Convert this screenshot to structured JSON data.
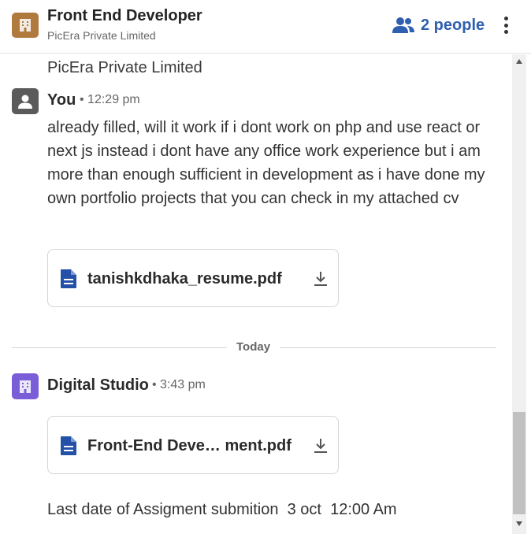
{
  "colors": {
    "org_logo": "#b07a3e",
    "digital_studio_logo": "#7a5ed8",
    "you_avatar": "#5b5b5b",
    "accent": "#2f5fb0",
    "file_icon": "#2451a8"
  },
  "header": {
    "title": "Front End Developer",
    "subtitle": "PicEra Private Limited",
    "people_label": "2 people",
    "people_icon": "people-icon",
    "more_icon": "kebab-menu-icon"
  },
  "thread": {
    "previous_text": "PicEra Private Limited",
    "message_1": {
      "sender": "You",
      "time": "• 12:29 pm",
      "text": "already filled, will it work if i dont work on php and use react or next js instead i dont have any office work experience but i am more than enough sufficient in development as i have done my own portfolio projects that you can check in my attached cv",
      "attachment": "tanishkdhaka_resume.pdf"
    },
    "divider_label": "Today",
    "message_2": {
      "sender": "Digital Studio",
      "time": "• 3:43 pm",
      "attachment": "Front-End Deve… ment.pdf",
      "text": "Last date of Assigment submition  3 oct  12:00 Am"
    }
  }
}
